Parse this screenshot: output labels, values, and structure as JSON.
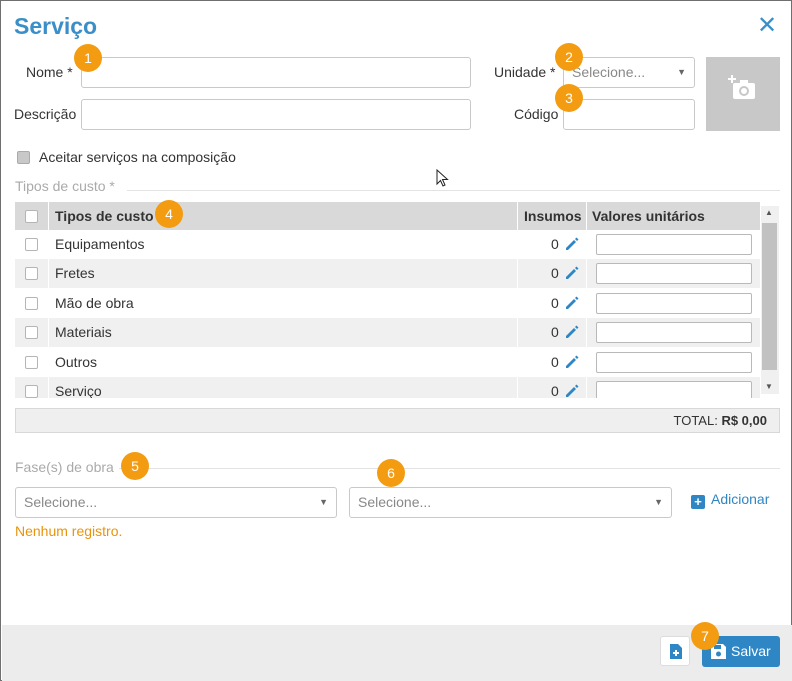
{
  "dialog": {
    "title": "Serviço",
    "close_icon": "✕"
  },
  "form": {
    "nome_label": "Nome *",
    "descricao_label": "Descrição",
    "unidade_label": "Unidade *",
    "unidade_placeholder": "Selecione...",
    "codigo_label": "Código",
    "aceitar_label": "Aceitar serviços na composição"
  },
  "badges": [
    "1",
    "2",
    "3",
    "4",
    "5",
    "6",
    "7"
  ],
  "tipos_custo": {
    "section_title": "Tipos de custo *",
    "columns": {
      "tipo": "Tipos de custo",
      "insumos": "Insumos",
      "valores": "Valores unitários"
    },
    "rows": [
      {
        "name": "Equipamentos",
        "insumos": "0"
      },
      {
        "name": "Fretes",
        "insumos": "0"
      },
      {
        "name": "Mão de obra",
        "insumos": "0"
      },
      {
        "name": "Materiais",
        "insumos": "0"
      },
      {
        "name": "Outros",
        "insumos": "0"
      },
      {
        "name": "Serviço",
        "insumos": "0"
      }
    ],
    "total_label": "TOTAL:",
    "total_value": "R$ 0,00"
  },
  "fases": {
    "section_title": "Fase(s) de obra",
    "select1_placeholder": "Selecione...",
    "select2_placeholder": "Selecione...",
    "add_label": "Adicionar",
    "empty_text": "Nenhum registro."
  },
  "footer": {
    "save_label": "Salvar"
  },
  "colors": {
    "accent": "#3a8fc8",
    "badge": "#f39c12",
    "warning_text": "#e8940c"
  }
}
